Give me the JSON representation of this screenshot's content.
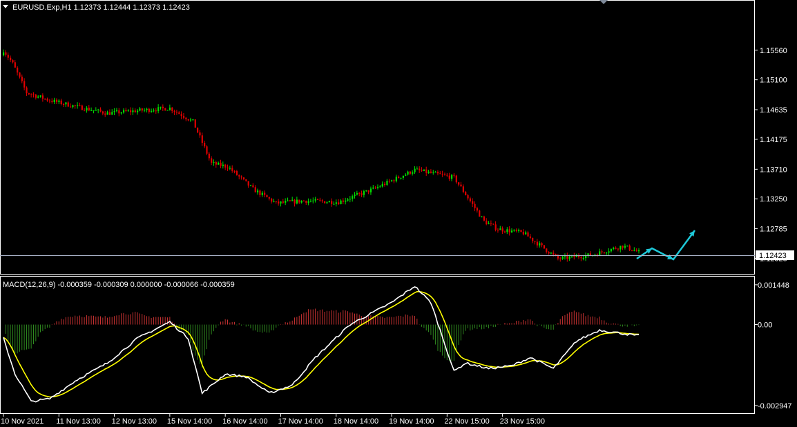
{
  "window": {
    "symbol_header": "EURUSD.Exp,H1  1.12373 1.12444 1.12373 1.12423",
    "current_price_label": "1.12423"
  },
  "colors": {
    "bull": "#00e000",
    "bear": "#e00000",
    "macd_line": "#ffffff",
    "signal_line": "#ffff00",
    "hist_positive": "#c83232",
    "hist_negative": "#2f8a1f",
    "arrows": "#1ec8d8",
    "price_line": "#aab4c8"
  },
  "chart_data": [
    {
      "type": "candlestick",
      "title": "EURUSD.Exp,H1  1.12373 1.12444 1.12373 1.12423",
      "ylim": [
        1.1218,
        1.1604
      ],
      "y_ticks": [
        "1.15560",
        "1.15100",
        "1.14635",
        "1.14175",
        "1.13710",
        "1.13250",
        "1.12785",
        "1.12325"
      ],
      "y_tick_values": [
        1.1556,
        1.151,
        1.14635,
        1.14175,
        1.1371,
        1.1325,
        1.12785,
        1.12325
      ],
      "current_price": 1.12423,
      "price_path": {
        "bars": [
          0,
          4,
          10,
          20,
          32,
          45,
          58,
          72,
          82,
          90,
          97,
          108,
          118,
          130,
          145,
          160,
          178,
          195,
          208,
          214,
          225,
          240,
          255,
          268,
          275
        ],
        "close": [
          1.1556,
          1.1535,
          1.149,
          1.1478,
          1.1468,
          1.1458,
          1.1462,
          1.1466,
          1.1445,
          1.138,
          1.1375,
          1.134,
          1.1318,
          1.1322,
          1.132,
          1.134,
          1.137,
          1.1358,
          1.129,
          1.1278,
          1.1272,
          1.1232,
          1.1238,
          1.1252,
          1.1242
        ]
      },
      "bar_count": 276,
      "projection_arrows": "three cyan arrows to the right of the last bar (up, down, up)"
    },
    {
      "type": "line",
      "title": "MACD(12,26,9) -0.000359 -0.000309 0.000000 -0.000066 -0.000359",
      "series": [
        {
          "name": "MACD",
          "role": "main line"
        },
        {
          "name": "Signal",
          "role": "signal line"
        },
        {
          "name": "Histogram",
          "role": "OsMA histogram"
        }
      ],
      "ylim": [
        -0.00305,
        0.00152
      ],
      "y_ticks": [
        "0.001448",
        "0.00",
        "-0.002947"
      ],
      "y_tick_values": [
        0.001448,
        0.0,
        -0.002947
      ],
      "macd_path": {
        "bars": [
          0,
          5,
          12,
          20,
          32,
          45,
          58,
          72,
          80,
          86,
          96,
          105,
          115,
          125,
          135,
          150,
          168,
          178,
          185,
          195,
          200,
          210,
          220,
          228,
          238,
          248,
          258,
          266,
          274
        ],
        "values": [
          -0.0005,
          -0.0018,
          -0.0028,
          -0.0027,
          -0.002,
          -0.0014,
          -0.0005,
          0.0001,
          -0.0005,
          -0.0025,
          -0.0018,
          -0.0019,
          -0.0025,
          -0.0022,
          -0.0012,
          0.0,
          0.0008,
          0.0014,
          0.0008,
          -0.0017,
          -0.0014,
          -0.0016,
          -0.0015,
          -0.0012,
          -0.0016,
          -0.0006,
          -0.0002,
          -0.0003,
          -0.0004
        ]
      }
    }
  ],
  "time_axis": {
    "labels": [
      "10 Nov 2021",
      "11 Nov 13:00",
      "12 Nov 13:00",
      "15 Nov 14:00",
      "16 Nov 14:00",
      "17 Nov 14:00",
      "18 Nov 14:00",
      "19 Nov 14:00",
      "22 Nov 15:00",
      "23 Nov 15:00"
    ],
    "label_bars": [
      0,
      24,
      48,
      72,
      96,
      120,
      144,
      168,
      192,
      216
    ]
  }
}
